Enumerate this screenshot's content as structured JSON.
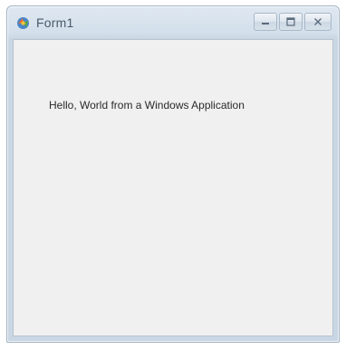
{
  "window": {
    "title": "Form1",
    "app_icon": "winforms-app-icon",
    "caption_buttons": [
      {
        "name": "minimize-button",
        "icon": "minimize-icon"
      },
      {
        "name": "maximize-button",
        "icon": "maximize-icon"
      },
      {
        "name": "close-button",
        "icon": "close-icon"
      }
    ]
  },
  "form": {
    "label_text": "Hello, World from a Windows Application"
  }
}
